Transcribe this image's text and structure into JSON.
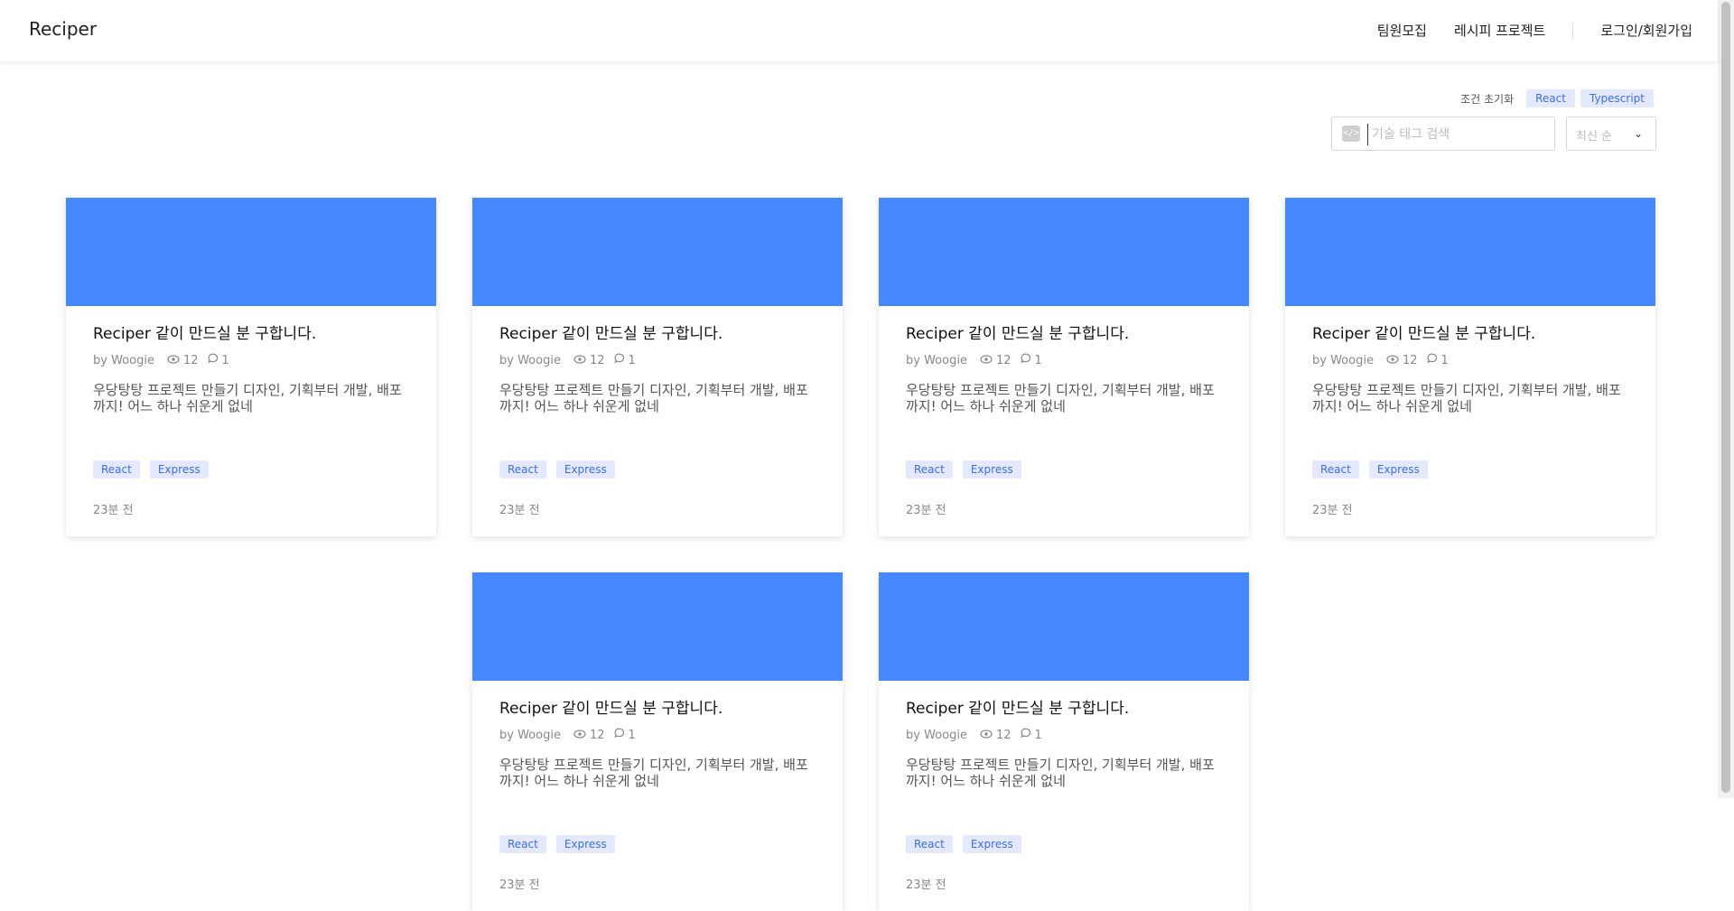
{
  "header": {
    "logo": "Reciper",
    "nav": [
      "팀원모집",
      "레시피 프로젝트"
    ],
    "auth": "로그인/회원가입"
  },
  "filters": {
    "reset_label": "조건 초기화",
    "chips": [
      "React",
      "Typescript"
    ],
    "search_placeholder": "기술 태그 검색",
    "sort_value": "최신 순"
  },
  "cards": [
    {
      "title": "Reciper 같이 만드실 분 구합니다.",
      "author": "by Woogie",
      "views": "12",
      "comments": "1",
      "desc": "우당탕탕 프로젝트 만들기 디자인, 기획부터 개발, 배포까지! 어느 하나 쉬운게 없네",
      "tags": [
        "React",
        "Express"
      ],
      "time": "23분 전"
    },
    {
      "title": "Reciper 같이 만드실 분 구합니다.",
      "author": "by Woogie",
      "views": "12",
      "comments": "1",
      "desc": "우당탕탕 프로젝트 만들기 디자인, 기획부터 개발, 배포까지! 어느 하나 쉬운게 없네",
      "tags": [
        "React",
        "Express"
      ],
      "time": "23분 전"
    },
    {
      "title": "Reciper 같이 만드실 분 구합니다.",
      "author": "by Woogie",
      "views": "12",
      "comments": "1",
      "desc": "우당탕탕 프로젝트 만들기 디자인, 기획부터 개발, 배포까지! 어느 하나 쉬운게 없네",
      "tags": [
        "React",
        "Express"
      ],
      "time": "23분 전"
    },
    {
      "title": "Reciper 같이 만드실 분 구합니다.",
      "author": "by Woogie",
      "views": "12",
      "comments": "1",
      "desc": "우당탕탕 프로젝트 만들기 디자인, 기획부터 개발, 배포까지! 어느 하나 쉬운게 없네",
      "tags": [
        "React",
        "Express"
      ],
      "time": "23분 전"
    },
    {
      "title": "Reciper 같이 만드실 분 구합니다.",
      "author": "by Woogie",
      "views": "12",
      "comments": "1",
      "desc": "우당탕탕 프로젝트 만들기 디자인, 기획부터 개발, 배포까지! 어느 하나 쉬운게 없네",
      "tags": [
        "React",
        "Express"
      ],
      "time": "23분 전"
    },
    {
      "title": "Reciper 같이 만드실 분 구합니다.",
      "author": "by Woogie",
      "views": "12",
      "comments": "1",
      "desc": "우당탕탕 프로젝트 만들기 디자인, 기획부터 개발, 배포까지! 어느 하나 쉬운게 없네",
      "tags": [
        "React",
        "Express"
      ],
      "time": "23분 전"
    }
  ],
  "colors": {
    "thumb": "#4688ff",
    "chip_bg": "#e4e9ff",
    "chip_text": "#3b6ef0"
  }
}
